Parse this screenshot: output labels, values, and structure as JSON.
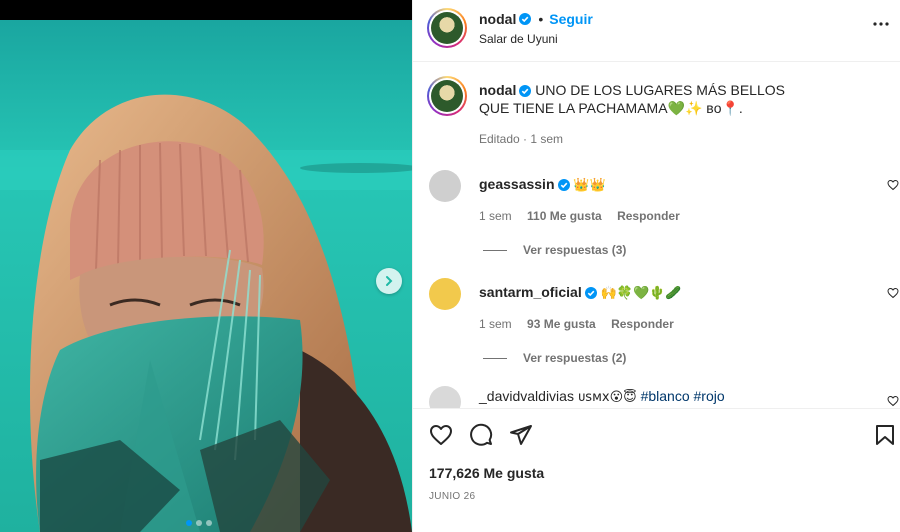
{
  "post": {
    "username": "nodal",
    "follow_label": "Seguir",
    "separator": "•",
    "location": "Salar de Uyuni",
    "caption": {
      "username": "nodal",
      "text": "UNO DE LOS LUGARES MÁS BELLOS QUE TIENE LA PACHAMAMA💚✨ ʙᴏ📍.",
      "meta": "Editado · 1 sem"
    },
    "likes": "177,626 Me gusta",
    "date": "JUNIO 26"
  },
  "comments": [
    {
      "username": "geassassin",
      "text": "👑👑",
      "time": "1 sem",
      "likes": "110 Me gusta",
      "reply_label": "Responder",
      "replies_label": "Ver respuestas (3)",
      "avatar_color": "#cfcfcf"
    },
    {
      "username": "santarm_oficial",
      "text": "🙌🍀💚🌵🥒",
      "time": "1 sem",
      "likes": "93 Me gusta",
      "reply_label": "Responder",
      "replies_label": "Ver respuestas (2)",
      "avatar_color": "#f2c94c"
    },
    {
      "username": "_davidvaldivias",
      "text_prefix": "ᴜsᴍx😮😇",
      "tags": [
        "#blanco",
        "#rojo"
      ],
      "avatar_color": "#d9d9d9"
    }
  ],
  "icons": {
    "more": "more-horizontal-icon",
    "verified": "verified-badge-icon",
    "like": "heart-icon",
    "comment": "comment-icon",
    "share": "share-icon",
    "save": "bookmark-icon",
    "next": "chevron-right-icon"
  },
  "colors": {
    "accent": "#0095f6",
    "text": "#262626",
    "secondary": "#737373",
    "photo_teal": "#1fb9a6"
  }
}
